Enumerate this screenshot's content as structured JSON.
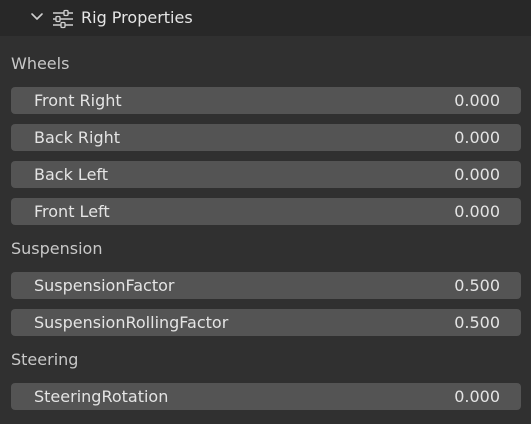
{
  "panel": {
    "title": "Rig Properties",
    "expanded": true,
    "collapse_icon": "chevron-down-icon",
    "title_icon": "sliders-icon"
  },
  "sections": {
    "wheels": {
      "label": "Wheels",
      "fields": [
        {
          "label": "Front Right",
          "value": "0.000"
        },
        {
          "label": "Back Right",
          "value": "0.000"
        },
        {
          "label": "Back Left",
          "value": "0.000"
        },
        {
          "label": "Front Left",
          "value": "0.000"
        }
      ]
    },
    "suspension": {
      "label": "Suspension",
      "fields": [
        {
          "label": "SuspensionFactor",
          "value": "0.500"
        },
        {
          "label": "SuspensionRollingFactor",
          "value": "0.500"
        }
      ]
    },
    "steering": {
      "label": "Steering",
      "fields": [
        {
          "label": "SteeringRotation",
          "value": "0.000"
        }
      ]
    }
  },
  "colors": {
    "background": "#303030",
    "header_background": "#282828",
    "field_background": "#545454",
    "text": "#e4e4e4"
  }
}
